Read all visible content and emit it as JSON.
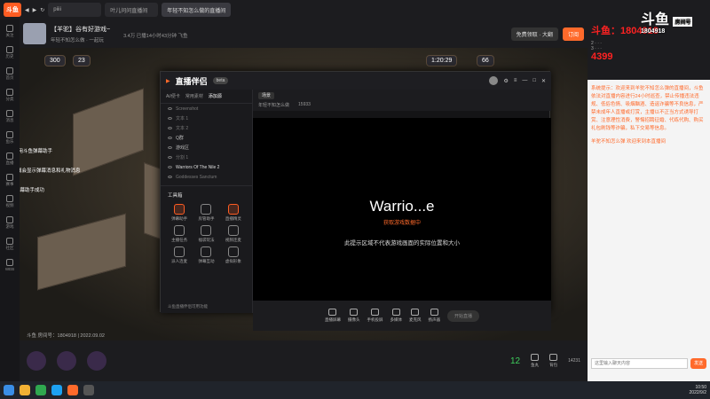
{
  "browser": {
    "logo": "斗鱼",
    "tabs": [
      "piiii",
      "叶儿问问直播间",
      "年轻不知怎么做的直播间"
    ],
    "address": "piiii"
  },
  "left_rail": [
    "关注",
    "历史",
    "首页",
    "分类",
    "消息",
    "鱼乐",
    "直播",
    "赛事",
    "视频",
    "游戏",
    "社区",
    "WEB"
  ],
  "stream_header": {
    "title": "【羊驼】谷有好游戏~",
    "meta": "年轻不知怎么做 · 一起玩",
    "stats": "3.4万  已播14小时43分钟  飞鱼",
    "follow_label": "免费领取 · 大翻",
    "subscribe_label": "订阅"
  },
  "hud": {
    "left_num": "300",
    "left_num2": "23",
    "right_time": "1:20:29",
    "right_num": "66"
  },
  "left_messages": [
    "恭迎使用斗鱼弹幕助手",
    "本区域会显示弹幕消息和礼物消息",
    "添加弹幕助手成功"
  ],
  "obs": {
    "app_name": "直播伴侣",
    "badge": "beta",
    "tabs": [
      "Ai/便卡",
      "常用素材",
      "添加源"
    ],
    "active_tab": "添加源",
    "scenes": [
      "Screenshot",
      "文本 1",
      "文本 2",
      "Q群",
      "游戏区",
      "分割 1",
      "Warriors Of The Nile 2",
      "Goddesses Sanctum"
    ],
    "toolbox_title": "工具箱",
    "tools": [
      "弹幕助手",
      "房管助手",
      "直播精灵",
      "主播任务",
      "福袋玩法",
      "视频连麦",
      "派人连麦",
      "弹幕互动",
      "虚拟形象"
    ],
    "bottom_note": "斗鱼直播伴侣可用功能",
    "scene_tab": "场景",
    "room_name": "年轻不知怎么做",
    "room_count": "15933",
    "preview_title": "Warrio...e",
    "preview_sub": "获取游戏数据中",
    "preview_hint": "此提示区域不代表游戏画面的实际位置和大小",
    "controls": [
      "直播屏幕",
      "摄像头",
      "手机投屏",
      "多媒体",
      "麦克风",
      "扬声器"
    ],
    "live_button": "开始直播",
    "stat_line": "直播时长 00:00:00  FPS 60  CPU 0%  内存 0%  带宽",
    "stats_right": "60FPS"
  },
  "right_panel": {
    "logo": "斗鱼",
    "room_label": "房间号",
    "room_number": "1804918",
    "ranks": [
      "2",
      "3",
      "4",
      "5"
    ],
    "overlay_red": [
      "斗鱼：1804918",
      "4399"
    ],
    "chat": [
      {
        "type": "sys",
        "text": "系统提示：欢迎来到羊驼不知怎么弹的直播间，斗鱼依法对直播内容进行24小时巡查，禁止传播违法违规、低俗色情、吸烟酗酒、造谣诈骗等不良信息，严禁未成年人直播或打赏，主播以不正当方式诱导打赏、注意理性消费，警惕招聘征婚、代练代购、购买礼包刷钱等诈骗，私下交易等信息。"
      },
      {
        "type": "user",
        "text": "羊驼不知怎么弹 欢迎来到本直播间"
      }
    ],
    "input_placeholder": "这里输入聊天内容",
    "send_label": "发送"
  },
  "bottom_bar": {
    "room_info": "斗鱼 房间号：1804918 | 2022.09.02",
    "level": "12",
    "gift_labels": [
      "鱼丸",
      "背包"
    ],
    "count": "14231"
  },
  "taskbar": {
    "time": "10:50",
    "date": "2022/9/2"
  }
}
